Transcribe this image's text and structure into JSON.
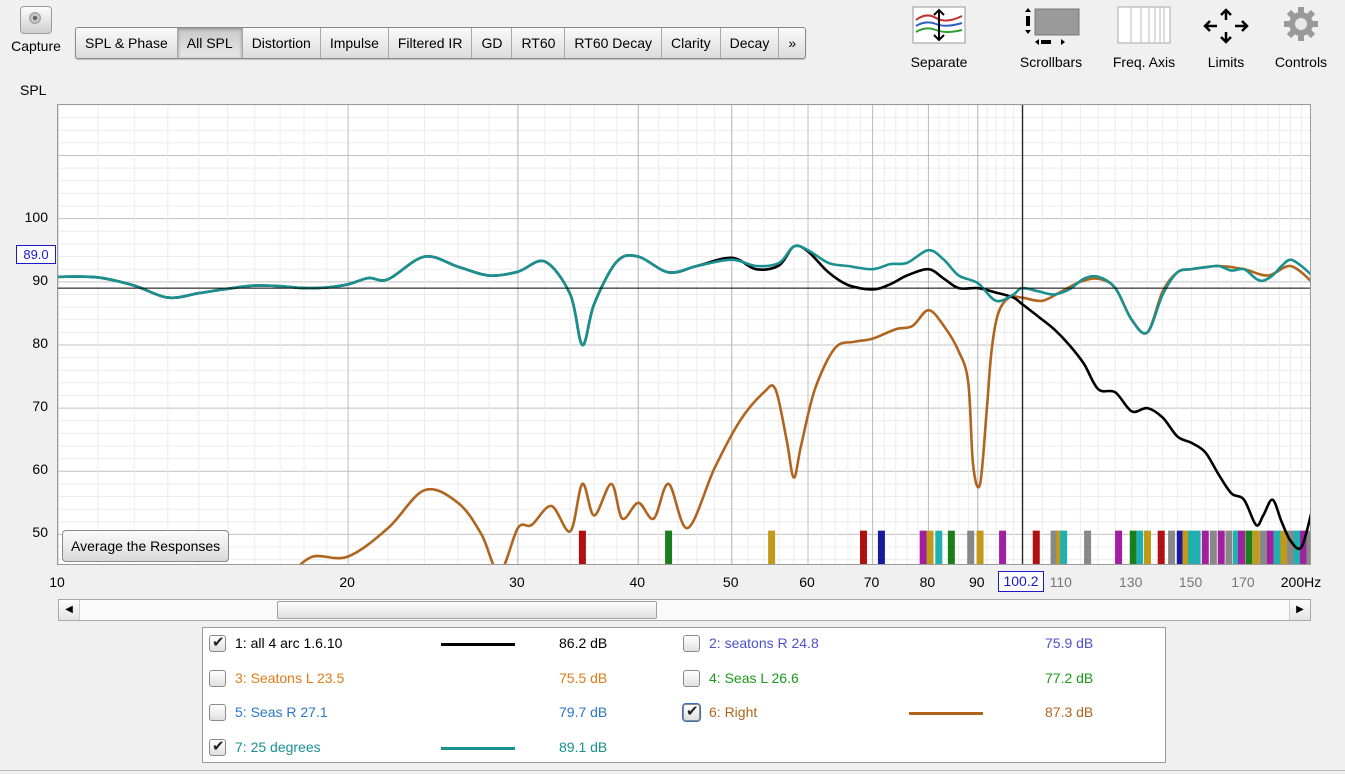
{
  "toolbar": {
    "capture_label": "Capture",
    "tabs": [
      "SPL & Phase",
      "All SPL",
      "Distortion",
      "Impulse",
      "Filtered IR",
      "GD",
      "RT60",
      "RT60 Decay",
      "Clarity",
      "Decay",
      "»"
    ],
    "active_tab": "All SPL",
    "tools": {
      "separate": "Separate",
      "scrollbars": "Scrollbars",
      "freq_axis": "Freq. Axis",
      "limits": "Limits",
      "controls": "Controls"
    }
  },
  "plot": {
    "y_unit": "SPL",
    "x_unit": "Hz",
    "average_button": "Average the Responses",
    "cursor_y": "89.0",
    "cursor_x": "100.2",
    "colors": {
      "black": "#000000",
      "teal": "#1a9090",
      "brown": "#b0651f",
      "grid": "#d4d4d4",
      "cursor": "#1a1acc"
    }
  },
  "chart_data": {
    "type": "line",
    "title": "",
    "xlabel": "Hz",
    "ylabel": "SPL",
    "x_scale": "log",
    "xlim": [
      10,
      200
    ],
    "ylim": [
      45,
      118
    ],
    "y_ticks": [
      "100",
      "90",
      "80",
      "70",
      "60",
      "50"
    ],
    "x_ticks_major": [
      "10",
      "20",
      "30",
      "40",
      "50",
      "60",
      "70",
      "80",
      "90",
      "200Hz"
    ],
    "x_ticks_minor": [
      "110",
      "130",
      "150",
      "170"
    ],
    "series": [
      {
        "name": "1: all 4 arc 1.6.10",
        "color": "#000000",
        "x": [
          10,
          11,
          12,
          13,
          14,
          15,
          16,
          17,
          18,
          19,
          20,
          21,
          22,
          24,
          26,
          28,
          30,
          32,
          34,
          35,
          36,
          38,
          40,
          43,
          46,
          50,
          53,
          56,
          58,
          60,
          63,
          66,
          70,
          73,
          76,
          80,
          83,
          86,
          90,
          94,
          98,
          100,
          104,
          108,
          112,
          116,
          120,
          125,
          130,
          135,
          140,
          145,
          150,
          155,
          160,
          165,
          170,
          175,
          178,
          182,
          186,
          190,
          195,
          200
        ],
        "y": [
          90.8,
          90.7,
          89.4,
          87.5,
          88.2,
          88.9,
          89.4,
          89.3,
          89.0,
          89.1,
          89.6,
          90.6,
          90.4,
          94.0,
          92.4,
          91.0,
          91.6,
          93.2,
          88.0,
          80.0,
          86.5,
          93.2,
          94.0,
          91.5,
          92.5,
          93.8,
          92.0,
          92.6,
          95.6,
          94.8,
          91.5,
          89.5,
          88.8,
          89.6,
          91.0,
          92.0,
          90.5,
          89.0,
          89.0,
          88.3,
          87.5,
          86.5,
          84.5,
          82.5,
          80.0,
          77.0,
          73.0,
          72.5,
          69.5,
          70.0,
          68.5,
          65.5,
          64.5,
          63.0,
          59.5,
          56.5,
          55.5,
          51.5,
          53.0,
          55.5,
          52.0,
          49.0,
          48.0,
          53.8
        ]
      },
      {
        "name": "7: 25 degrees",
        "color": "#1a9090",
        "x": [
          10,
          11,
          12,
          13,
          14,
          15,
          16,
          17,
          18,
          19,
          20,
          21,
          22,
          24,
          26,
          28,
          30,
          32,
          34,
          35,
          36,
          38,
          40,
          43,
          46,
          50,
          53,
          56,
          58,
          60,
          63,
          66,
          70,
          73,
          76,
          80,
          83,
          86,
          90,
          94,
          98,
          100,
          104,
          108,
          112,
          116,
          120,
          125,
          130,
          135,
          140,
          145,
          150,
          155,
          160,
          165,
          170,
          175,
          178,
          182,
          186,
          190,
          195,
          200
        ],
        "y": [
          90.8,
          90.7,
          89.4,
          87.5,
          88.2,
          88.9,
          89.4,
          89.3,
          89.0,
          89.1,
          89.6,
          90.6,
          90.4,
          94.0,
          92.4,
          91.0,
          91.6,
          93.2,
          88.0,
          80.0,
          86.5,
          93.2,
          94.0,
          91.5,
          92.5,
          93.5,
          92.5,
          93.0,
          95.6,
          95.0,
          93.0,
          92.5,
          92.0,
          92.8,
          93.0,
          95.0,
          93.5,
          91.0,
          89.8,
          87.0,
          88.0,
          89.0,
          88.5,
          88.0,
          88.8,
          90.5,
          90.8,
          89.0,
          84.0,
          82.0,
          88.0,
          91.5,
          92.0,
          92.3,
          92.5,
          91.8,
          92.0,
          90.5,
          90.2,
          91.0,
          92.5,
          93.5,
          92.5,
          91.0
        ]
      },
      {
        "name": "6: Right",
        "color": "#b0651f",
        "x": [
          17.5,
          18.4,
          20,
          22,
          24,
          26,
          27.5,
          28.7,
          30,
          31,
          32.5,
          34,
          35,
          36,
          37.5,
          38.5,
          40,
          41.5,
          43,
          45,
          48,
          51,
          54,
          55.5,
          57,
          58,
          59,
          61,
          64,
          67,
          70,
          74,
          77,
          80,
          83,
          86,
          88,
          89,
          90.5,
          92,
          93,
          94.5,
          97,
          100,
          105,
          110,
          115,
          120,
          125,
          130,
          135,
          140,
          145,
          150,
          160,
          170,
          180,
          190,
          200
        ],
        "y": [
          44.0,
          46.5,
          46.5,
          51.0,
          57.0,
          55.0,
          50.0,
          44.0,
          51.0,
          51.5,
          54.5,
          50.5,
          58.0,
          53.0,
          58.0,
          52.5,
          55.0,
          52.5,
          58.0,
          51.0,
          60.5,
          68.0,
          72.5,
          73.0,
          65.0,
          59.0,
          64.0,
          73.0,
          79.5,
          80.5,
          81.0,
          82.5,
          83.0,
          85.5,
          83.0,
          79.0,
          74.0,
          61.0,
          58.0,
          70.0,
          79.0,
          85.0,
          87.5,
          87.5,
          87.0,
          88.5,
          90.0,
          90.5,
          89.0,
          84.0,
          82.0,
          88.5,
          91.5,
          92.0,
          92.5,
          92.0,
          91.0,
          92.5,
          90.0
        ]
      }
    ],
    "markers_hz": [
      {
        "x": 35.0,
        "c": "#b01010"
      },
      {
        "x": 43.0,
        "c": "#1a7f1a"
      },
      {
        "x": 55.0,
        "c": "#c29a1a"
      },
      {
        "x": 68.5,
        "c": "#b01010"
      },
      {
        "x": 71.5,
        "c": "#1a1aa0"
      },
      {
        "x": 79.0,
        "c": "#a020a0"
      },
      {
        "x": 80.3,
        "c": "#c29a1a"
      },
      {
        "x": 82.0,
        "c": "#20b0b0"
      },
      {
        "x": 84.5,
        "c": "#1a7f1a"
      },
      {
        "x": 88.5,
        "c": "#888888"
      },
      {
        "x": 90.5,
        "c": "#c29a1a"
      },
      {
        "x": 95.5,
        "c": "#a020a0"
      },
      {
        "x": 103.5,
        "c": "#b01010"
      },
      {
        "x": 108.0,
        "c": "#888888"
      },
      {
        "x": 109.5,
        "c": "#c29a1a"
      },
      {
        "x": 110.5,
        "c": "#20b0b0"
      },
      {
        "x": 117.0,
        "c": "#888888"
      },
      {
        "x": 126.0,
        "c": "#a020a0"
      },
      {
        "x": 130.5,
        "c": "#1a7f1a"
      },
      {
        "x": 132.5,
        "c": "#20b0b0"
      },
      {
        "x": 135.0,
        "c": "#c29a1a"
      },
      {
        "x": 139.5,
        "c": "#b01010"
      },
      {
        "x": 143.0,
        "c": "#888888"
      },
      {
        "x": 146.0,
        "c": "#1a1aa0"
      },
      {
        "x": 148.0,
        "c": "#c29a1a"
      },
      {
        "x": 150.0,
        "c": "#20b0b0"
      },
      {
        "x": 152.0,
        "c": "#20b0b0"
      },
      {
        "x": 155.0,
        "c": "#a020a0"
      },
      {
        "x": 158.0,
        "c": "#888888"
      },
      {
        "x": 161.0,
        "c": "#a020a0"
      },
      {
        "x": 164.0,
        "c": "#888888"
      },
      {
        "x": 167.0,
        "c": "#20b0b0"
      },
      {
        "x": 169.0,
        "c": "#a020a0"
      },
      {
        "x": 172.0,
        "c": "#1a7f1a"
      },
      {
        "x": 175.0,
        "c": "#c29a1a"
      },
      {
        "x": 178.0,
        "c": "#888888"
      },
      {
        "x": 181.0,
        "c": "#a020a0"
      },
      {
        "x": 184.0,
        "c": "#20b0b0"
      },
      {
        "x": 187.0,
        "c": "#c29a1a"
      },
      {
        "x": 190.0,
        "c": "#888888"
      },
      {
        "x": 193.0,
        "c": "#20b0b0"
      },
      {
        "x": 196.0,
        "c": "#a020a0"
      },
      {
        "x": 199.0,
        "c": "#888888"
      }
    ]
  },
  "legend": [
    {
      "name": "1: all 4 arc 1.6.10",
      "value": "86.2 dB",
      "color": "#000000",
      "checked": true,
      "line": true
    },
    {
      "name": "2: seatons R 24.8",
      "value": "75.9 dB",
      "color": "#5050c8",
      "checked": false,
      "line": false
    },
    {
      "name": "3: Seatons L 23.5",
      "value": "75.5 dB",
      "color": "#e07a1a",
      "checked": false,
      "line": false
    },
    {
      "name": "4: Seas L 26.6",
      "value": "77.2 dB",
      "color": "#1a9a1a",
      "checked": false,
      "line": false
    },
    {
      "name": "5: Seas R 27.1",
      "value": "79.7 dB",
      "color": "#2a78c8",
      "checked": false,
      "line": false
    },
    {
      "name": "6: Right",
      "value": "87.3 dB",
      "color": "#b0651f",
      "checked": true,
      "line": true
    },
    {
      "name": "7: 25 degrees",
      "value": "89.1 dB",
      "color": "#1a9090",
      "checked": true,
      "line": true
    }
  ]
}
